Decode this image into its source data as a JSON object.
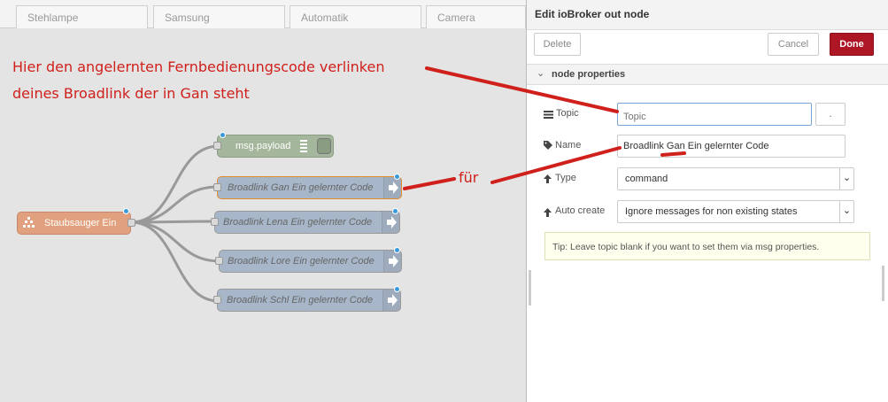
{
  "tabs": [
    "Stehlampe",
    "Samsung",
    "Automatik",
    "Camera"
  ],
  "annotations": {
    "line1": "Hier den angelernten Fernbedienungscode verlinken",
    "line2": "deines Broadlink der in Gan steht",
    "fuer": "für"
  },
  "flow": {
    "inject_node": "Staubsauger Ein",
    "debug_node": "msg.payload",
    "out_nodes": [
      "Broadlink Gan Ein gelernter Code",
      "Broadlink Lena Ein gelernter Code",
      "Broadlink Lore Ein gelernter Code",
      "Broadlink Schl Ein gelernter Code"
    ]
  },
  "tray": {
    "title": "Edit ioBroker out node",
    "delete_label": "Delete",
    "cancel_label": "Cancel",
    "done_label": "Done",
    "section_label": "node properties",
    "topic_label": "Topic",
    "topic_placeholder": "Topic",
    "topic_button": ".",
    "name_label": "Name",
    "name_value": "Broadlink Gan Ein gelernter Code",
    "type_label": "Type",
    "type_value": "command",
    "autocreate_label": "Auto create",
    "autocreate_value": "Ignore messages for non existing states",
    "tip": "Tip: Leave topic blank if you want to set them via msg properties."
  },
  "colors": {
    "annotation": "#d0201c",
    "done_button": "#ad1625",
    "out_node": "#a7b6c8",
    "inject_node": "#e2a17e",
    "debug_node": "#a4b69b",
    "link_dot": "#3a9ad9"
  }
}
